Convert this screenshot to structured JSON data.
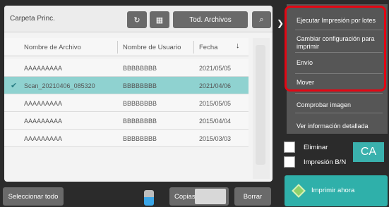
{
  "header": {
    "folder_title": "Carpeta Princ.",
    "filter_button": "Tod. Archivos"
  },
  "icons": {
    "refresh": "↻",
    "grid": "▦",
    "search": "⌕",
    "sort": "↓",
    "check": "✔",
    "expand": "❯"
  },
  "table": {
    "columns": [
      "Nombre de Archivo",
      "Nombre de Usuario",
      "Fecha"
    ],
    "rows": [
      {
        "name": "AAAAAAAAA",
        "user": "BBBBBBBB",
        "date": "2021/05/05",
        "selected": false
      },
      {
        "name": "Scan_20210406_085320",
        "user": "BBBBBBBB",
        "date": "2021/04/06",
        "selected": true
      },
      {
        "name": "AAAAAAAAA",
        "user": "BBBBBBBB",
        "date": "2015/05/05",
        "selected": false
      },
      {
        "name": "AAAAAAAAA",
        "user": "BBBBBBBB",
        "date": "2015/04/04",
        "selected": false
      },
      {
        "name": "AAAAAAAAA",
        "user": "BBBBBBBB",
        "date": "2015/03/03",
        "selected": false
      }
    ]
  },
  "actions": {
    "batch_print": "Ejecutar Impresión por lotes",
    "change_print": "Cambiar configuración para imprimir",
    "send": "Envío",
    "move": "Mover",
    "check_image": "Comprobar imagen",
    "view_details": "Ver información detallada"
  },
  "options": {
    "delete": "Eliminar",
    "bw_print": "Impresión B/N",
    "ca": "CA"
  },
  "bottom": {
    "select_all": "Seleccionar todo",
    "copies": "Copias",
    "delete_button": "Borrar",
    "print_now": "Imprimir ahora"
  },
  "colors": {
    "selected_row": "#8fd2d0",
    "accent": "#2fb0aa",
    "highlight_border": "#e30613"
  }
}
